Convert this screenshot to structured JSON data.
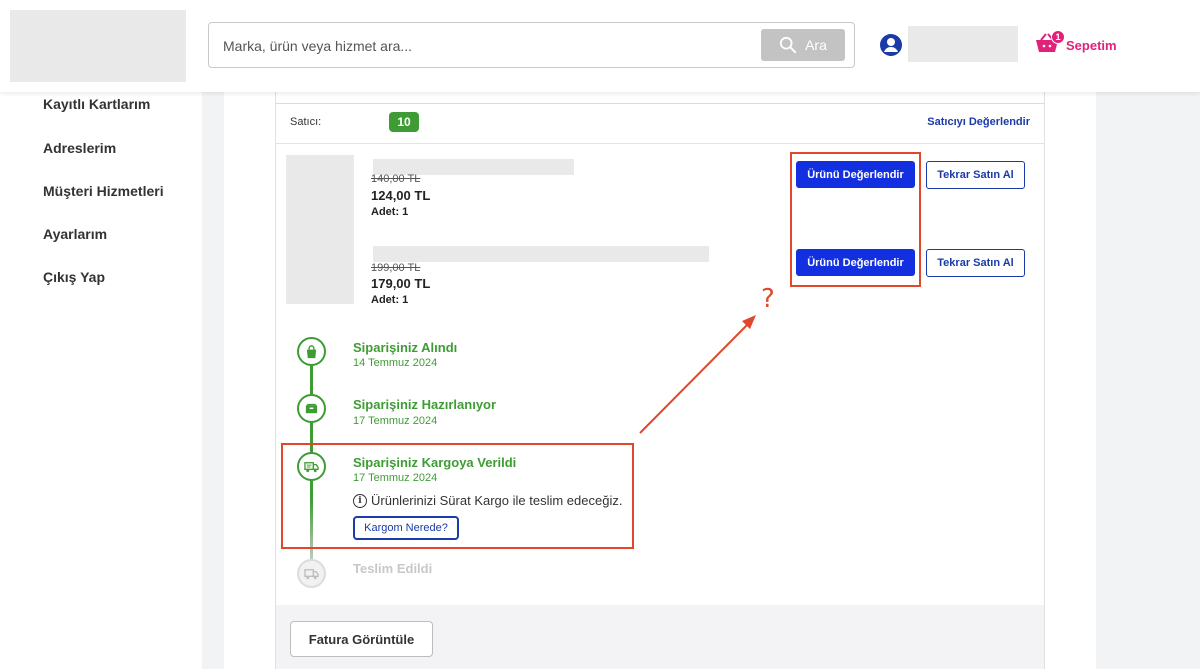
{
  "header": {
    "search_placeholder": "Marka, ürün veya hizmet ara...",
    "search_button": "Ara",
    "cart_label": "Sepetim",
    "cart_count": "1"
  },
  "sidebar": {
    "items": [
      {
        "label": "Kayıtlı Kartlarım"
      },
      {
        "label": "Adreslerim"
      },
      {
        "label": "Müşteri Hizmetleri"
      },
      {
        "label": "Ayarlarım"
      },
      {
        "label": "Çıkış Yap"
      }
    ]
  },
  "order": {
    "seller_label": "Satıcı:",
    "seller_score": "10",
    "rate_seller": "Satıcıyı Değerlendir",
    "products": [
      {
        "old_price": "140,00 TL",
        "price": "124,00 TL",
        "qty": "Adet: 1",
        "rate_button": "Ürünü Değerlendir",
        "rebuy_button": "Tekrar Satın Al"
      },
      {
        "old_price": "199,00 TL",
        "price": "179,00 TL",
        "qty": "Adet: 1",
        "rate_button": "Ürünü Değerlendir",
        "rebuy_button": "Tekrar Satın Al"
      }
    ],
    "timeline": [
      {
        "title": "Siparişiniz Alındı",
        "date": "14 Temmuz 2024",
        "icon": "shopping-bag-icon",
        "done": true
      },
      {
        "title": "Siparişiniz Hazırlanıyor",
        "date": "17 Temmuz 2024",
        "icon": "box-icon",
        "done": true
      },
      {
        "title": "Siparişiniz Kargoya Verildi",
        "date": "17 Temmuz 2024",
        "icon": "truck-icon",
        "done": true
      },
      {
        "title": "Teslim Edildi",
        "date": "",
        "icon": "delivered-truck-icon",
        "done": false
      }
    ],
    "shipping_info": "Ürünlerinizi Sürat Kargo ile teslim edeceğiz.",
    "track_button": "Kargom Nerede?",
    "invoice_button": "Fatura Görüntüle"
  },
  "annotation": {
    "question_mark": "?"
  },
  "colors": {
    "accent_blue": "#1230e0",
    "success_green": "#3f9c35",
    "brand_pink": "#e0227a",
    "annotation_red": "#e0472b"
  }
}
